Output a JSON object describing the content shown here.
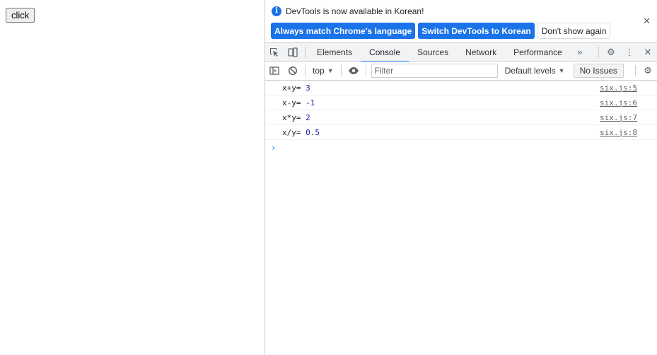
{
  "page": {
    "button_label": "click"
  },
  "infobar": {
    "message": "DevTools is now available in Korean!",
    "info_icon": "i",
    "close_icon": "✕",
    "buttons": {
      "match_language": "Always match Chrome's language",
      "switch_korean": "Switch DevTools to Korean",
      "dont_show": "Don't show again"
    }
  },
  "tabs": [
    "Elements",
    "Console",
    "Sources",
    "Network",
    "Performance"
  ],
  "tabbar_icons": {
    "inspect": "⬚",
    "device": "▯",
    "more_tabs": "»",
    "settings": "⚙",
    "menu": "⋮",
    "close": "✕"
  },
  "console_toolbar": {
    "sidebar_icon": "▸",
    "clear_icon": "⊘",
    "context": "top",
    "eye_icon": "◉",
    "filter_placeholder": "Filter",
    "levels": "Default levels",
    "issues": "No Issues",
    "settings_icon": "⚙",
    "caret": "▼"
  },
  "messages": [
    {
      "expr": "x+y= ",
      "value": "3",
      "source": "six.js:5"
    },
    {
      "expr": "x-y= ",
      "value": "-1",
      "source": "six.js:6"
    },
    {
      "expr": "x*y= ",
      "value": "2",
      "source": "six.js:7"
    },
    {
      "expr": "x/y= ",
      "value": "0.5",
      "source": "six.js:8"
    }
  ],
  "prompt": "›",
  "colors": {
    "accent": "#1a73e8",
    "number": "#1a1aa6"
  }
}
